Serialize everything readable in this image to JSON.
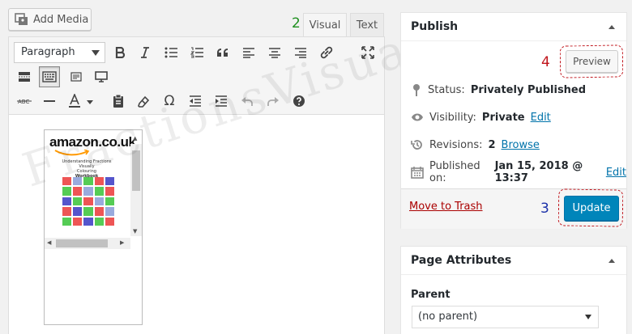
{
  "editor": {
    "add_media_label": "Add Media",
    "tabs": [
      {
        "label": "Visual",
        "active": true
      },
      {
        "label": "Text",
        "active": false
      }
    ],
    "format_select_value": "Paragraph"
  },
  "annotations": {
    "marker_2": "2",
    "marker_3": "3",
    "marker_4": "4"
  },
  "content": {
    "image_brand": "amazon.co.uk",
    "book_title_line1": "Understanding Fractions Visually",
    "book_title_line2": "Colouring",
    "book_title_line3": "Workbook"
  },
  "watermark": "FractionsVisually",
  "publish": {
    "title": "Publish",
    "preview_label": "Preview",
    "status_label": "Status:",
    "status_value": "Privately Published",
    "visibility_label": "Visibility:",
    "visibility_value": "Private",
    "visibility_edit": "Edit",
    "revisions_label": "Revisions:",
    "revisions_value": "2",
    "revisions_link": "Browse",
    "published_label": "Published on:",
    "published_value": "Jan 15, 2018 @ 13:37",
    "published_edit": "Edit",
    "trash_label": "Move to Trash",
    "update_label": "Update"
  },
  "page_attributes": {
    "title": "Page Attributes",
    "parent_label": "Parent",
    "parent_value": "(no parent)"
  },
  "colors": {
    "primary_button": "#0085ba",
    "link": "#0073aa",
    "trash": "#a00",
    "annotation_red": "#c0141b",
    "annotation_green": "#1e8f1e",
    "annotation_blue": "#1a2fa8"
  }
}
